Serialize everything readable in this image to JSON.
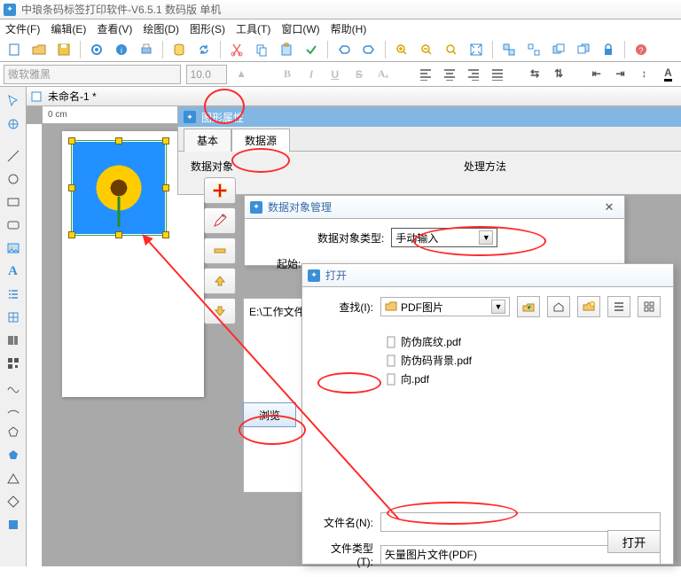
{
  "app": {
    "title": "中琅条码标签打印软件-V6.5.1 数码版 单机"
  },
  "menu": {
    "file": "文件(F)",
    "edit": "编辑(E)",
    "view": "查看(V)",
    "draw": "绘图(D)",
    "shape": "图形(S)",
    "tools": "工具(T)",
    "window": "窗口(W)",
    "help": "帮助(H)"
  },
  "font": {
    "name": "微软雅黑",
    "size": "10.0"
  },
  "doc": {
    "title": "未命名-1 *",
    "ruler": "0 cm"
  },
  "props": {
    "title": "图形属性",
    "tab_basic": "基本",
    "tab_data": "数据源",
    "left_head": "数据对象",
    "right_head": "处理方法",
    "path": "E:\\工作文件"
  },
  "browse": {
    "label": "浏览"
  },
  "dom": {
    "title": "数据对象管理",
    "type_label": "数据对象类型:",
    "type_value": "手动输入",
    "start_label": "起始:"
  },
  "open": {
    "title": "打开",
    "look_label": "查找(I):",
    "look_value": "PDF图片",
    "files": [
      "防伪底纹.pdf",
      "防伪码背景.pdf",
      "向.pdf"
    ],
    "name_label": "文件名(N):",
    "name_value": "",
    "type_label": "文件类型(T):",
    "type_value": "矢量图片文件(PDF)",
    "open_btn": "打开"
  }
}
